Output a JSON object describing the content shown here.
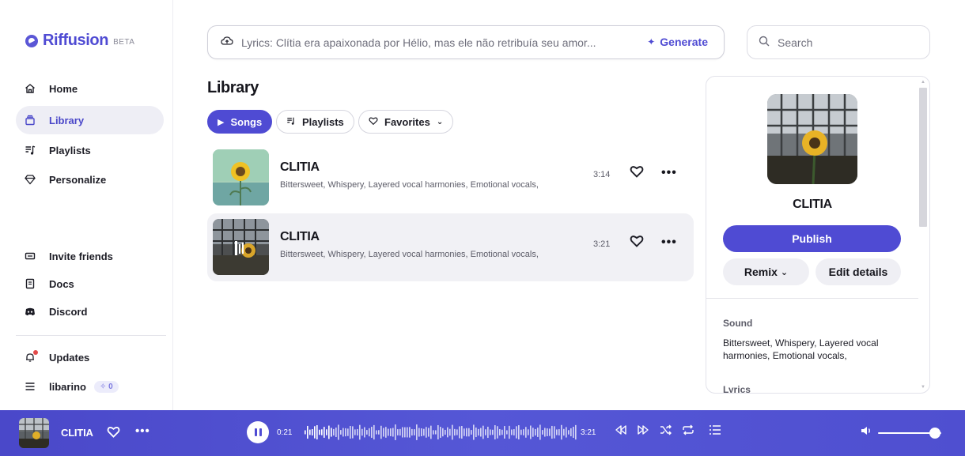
{
  "brand": {
    "name": "Riffusion",
    "badge": "BETA",
    "color": "#4f4bd3"
  },
  "sidebar": {
    "items": [
      {
        "label": "Home",
        "icon": "home-icon"
      },
      {
        "label": "Library",
        "icon": "library-icon",
        "active": true
      },
      {
        "label": "Playlists",
        "icon": "playlist-icon"
      },
      {
        "label": "Personalize",
        "icon": "diamond-icon"
      }
    ],
    "lower_items": [
      {
        "label": "Invite friends",
        "icon": "ticket-icon"
      },
      {
        "label": "Docs",
        "icon": "doc-icon"
      },
      {
        "label": "Discord",
        "icon": "discord-icon"
      }
    ],
    "updates_label": "Updates",
    "user": {
      "name": "libarino",
      "credits": "0"
    }
  },
  "prompt": {
    "text": "Lyrics: Clítia era apaixonada por Hélio, mas ele não retribuía seu amor...",
    "generate_label": "Generate"
  },
  "search": {
    "placeholder": "Search"
  },
  "library": {
    "title": "Library",
    "filters": [
      {
        "label": "Songs",
        "active": true
      },
      {
        "label": "Playlists"
      },
      {
        "label": "Favorites"
      }
    ],
    "songs": [
      {
        "title": "CLITIA",
        "tags": "Bittersweet, Whispery, Layered vocal harmonies, Emotional vocals,",
        "duration": "3:14"
      },
      {
        "title": "CLITIA",
        "tags": "Bittersweet, Whispery, Layered vocal harmonies, Emotional vocals,",
        "duration": "3:21",
        "playing": true
      }
    ]
  },
  "detail": {
    "title": "CLITIA",
    "publish_label": "Publish",
    "remix_label": "Remix",
    "edit_label": "Edit details",
    "sound_label": "Sound",
    "sound_text": "Bittersweet, Whispery, Layered vocal harmonies, Emotional vocals,",
    "lyrics_label": "Lyrics"
  },
  "player": {
    "title": "CLITIA",
    "current_time": "0:21",
    "total_time": "3:21",
    "progress": 0.1,
    "volume": 0.9
  }
}
